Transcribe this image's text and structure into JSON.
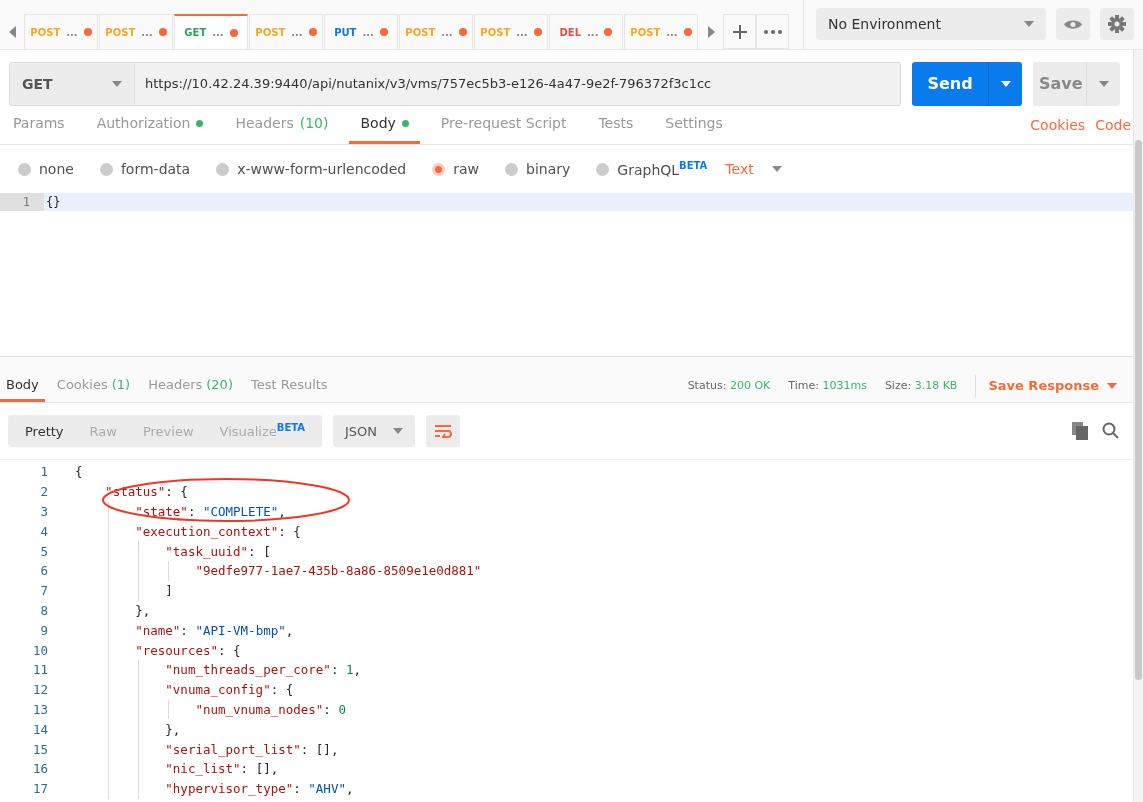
{
  "tabs": [
    {
      "method": "POST",
      "name": "...",
      "color": "#f5a623",
      "selected": false,
      "unsaved": true
    },
    {
      "method": "POST",
      "name": "...",
      "color": "#f5a623",
      "selected": false,
      "unsaved": true
    },
    {
      "method": "GET",
      "name": "...",
      "color": "#2ba35b",
      "selected": true,
      "unsaved": true
    },
    {
      "method": "POST",
      "name": "...",
      "color": "#f5a623",
      "selected": false,
      "unsaved": true
    },
    {
      "method": "PUT",
      "name": "...",
      "color": "#097bed",
      "selected": false,
      "unsaved": true
    },
    {
      "method": "POST",
      "name": "...",
      "color": "#f5a623",
      "selected": false,
      "unsaved": true
    },
    {
      "method": "POST",
      "name": "...",
      "color": "#f5a623",
      "selected": false,
      "unsaved": true
    },
    {
      "method": "DEL",
      "name": "...",
      "color": "#ed4b48",
      "selected": false,
      "unsaved": true
    },
    {
      "method": "POST",
      "name": "...",
      "color": "#f5a623",
      "selected": false,
      "unsaved": true
    }
  ],
  "environment": {
    "value": "No Environment"
  },
  "request": {
    "method": "GET",
    "url": "https://10.42.24.39:9440/api/nutanix/v3/vms/757ec5b3-e126-4a47-9e2f-796372f3c1cc",
    "send": "Send",
    "save": "Save"
  },
  "request_tabs": [
    {
      "label": "Params",
      "selected": false
    },
    {
      "label": "Authorization",
      "selected": false,
      "dot": true
    },
    {
      "label": "Headers",
      "count": "(10)",
      "selected": false
    },
    {
      "label": "Body",
      "selected": true,
      "dot": true
    },
    {
      "label": "Pre-request Script",
      "selected": false
    },
    {
      "label": "Tests",
      "selected": false
    },
    {
      "label": "Settings",
      "selected": false
    }
  ],
  "request_links": [
    "Cookies",
    "Code"
  ],
  "body_types": [
    {
      "label": "none",
      "selected": false
    },
    {
      "label": "form-data",
      "selected": false
    },
    {
      "label": "x-www-form-urlencoded",
      "selected": false
    },
    {
      "label": "raw",
      "selected": true
    },
    {
      "label": "binary",
      "selected": false
    },
    {
      "label": "GraphQL",
      "badge": "BETA",
      "selected": false
    }
  ],
  "body_format": "Text",
  "request_body": [
    {
      "number": "1",
      "text": "{}"
    }
  ],
  "response_tabs": [
    {
      "label": "Body",
      "selected": true
    },
    {
      "label": "Cookies",
      "count": "(1)",
      "selected": false
    },
    {
      "label": "Headers",
      "count": "(20)",
      "selected": false
    },
    {
      "label": "Test Results",
      "selected": false
    }
  ],
  "response_meta": [
    {
      "label": "Status:",
      "value": "200 OK"
    },
    {
      "label": "Time:",
      "value": "1031ms"
    },
    {
      "label": "Size:",
      "value": "3.18 KB"
    }
  ],
  "save_response": "Save Response",
  "view_modes": [
    {
      "label": "Pretty",
      "selected": true
    },
    {
      "label": "Raw",
      "selected": false
    },
    {
      "label": "Preview",
      "selected": false
    },
    {
      "label": "Visualize",
      "badge": "BETA",
      "selected": false
    }
  ],
  "response_format": "JSON",
  "response_body": [
    {
      "number": "1",
      "tokens": [
        {
          "kind": "punct",
          "text": "{"
        }
      ]
    },
    {
      "number": "2",
      "tokens": [
        {
          "kind": "key",
          "text": "    \"status\""
        },
        {
          "kind": "punct",
          "text": ": {"
        }
      ]
    },
    {
      "number": "3",
      "tokens": [
        {
          "kind": "key",
          "text": "        \"state\""
        },
        {
          "kind": "punct",
          "text": ": "
        },
        {
          "kind": "string",
          "text": "\"COMPLETE\""
        },
        {
          "kind": "punct",
          "text": ","
        }
      ]
    },
    {
      "number": "4",
      "tokens": [
        {
          "kind": "key",
          "text": "        \"execution_context\""
        },
        {
          "kind": "punct",
          "text": ": {"
        }
      ]
    },
    {
      "number": "5",
      "tokens": [
        {
          "kind": "key",
          "text": "            \"task_uuid\""
        },
        {
          "kind": "punct",
          "text": ": ["
        }
      ]
    },
    {
      "number": "6",
      "tokens": [
        {
          "kind": "key",
          "text": "                \"9edfe977-1ae7-435b-8a86-8509e1e0d881\""
        }
      ]
    },
    {
      "number": "7",
      "tokens": [
        {
          "kind": "punct",
          "text": "            ]"
        }
      ]
    },
    {
      "number": "8",
      "tokens": [
        {
          "kind": "punct",
          "text": "        },"
        }
      ]
    },
    {
      "number": "9",
      "tokens": [
        {
          "kind": "key",
          "text": "        \"name\""
        },
        {
          "kind": "punct",
          "text": ": "
        },
        {
          "kind": "string",
          "text": "\"API-VM-bmp\""
        },
        {
          "kind": "punct",
          "text": ","
        }
      ]
    },
    {
      "number": "10",
      "tokens": [
        {
          "kind": "key",
          "text": "        \"resources\""
        },
        {
          "kind": "punct",
          "text": ": {"
        }
      ]
    },
    {
      "number": "11",
      "tokens": [
        {
          "kind": "key",
          "text": "            \"num_threads_per_core\""
        },
        {
          "kind": "punct",
          "text": ": "
        },
        {
          "kind": "number",
          "text": "1"
        },
        {
          "kind": "punct",
          "text": ","
        }
      ]
    },
    {
      "number": "12",
      "tokens": [
        {
          "kind": "key",
          "text": "            \"vnuma_config\""
        },
        {
          "kind": "punct",
          "text": ": {"
        }
      ]
    },
    {
      "number": "13",
      "tokens": [
        {
          "kind": "key",
          "text": "                \"num_vnuma_nodes\""
        },
        {
          "kind": "punct",
          "text": ": "
        },
        {
          "kind": "number",
          "text": "0"
        }
      ]
    },
    {
      "number": "14",
      "tokens": [
        {
          "kind": "punct",
          "text": "            },"
        }
      ]
    },
    {
      "number": "15",
      "tokens": [
        {
          "kind": "key",
          "text": "            \"serial_port_list\""
        },
        {
          "kind": "punct",
          "text": ": [],"
        }
      ]
    },
    {
      "number": "16",
      "tokens": [
        {
          "kind": "key",
          "text": "            \"nic_list\""
        },
        {
          "kind": "punct",
          "text": ": [],"
        }
      ]
    },
    {
      "number": "17",
      "tokens": [
        {
          "kind": "key",
          "text": "            \"hypervisor_type\""
        },
        {
          "kind": "punct",
          "text": ": "
        },
        {
          "kind": "string",
          "text": "\"AHV\""
        },
        {
          "kind": "punct",
          "text": ","
        }
      ]
    }
  ]
}
